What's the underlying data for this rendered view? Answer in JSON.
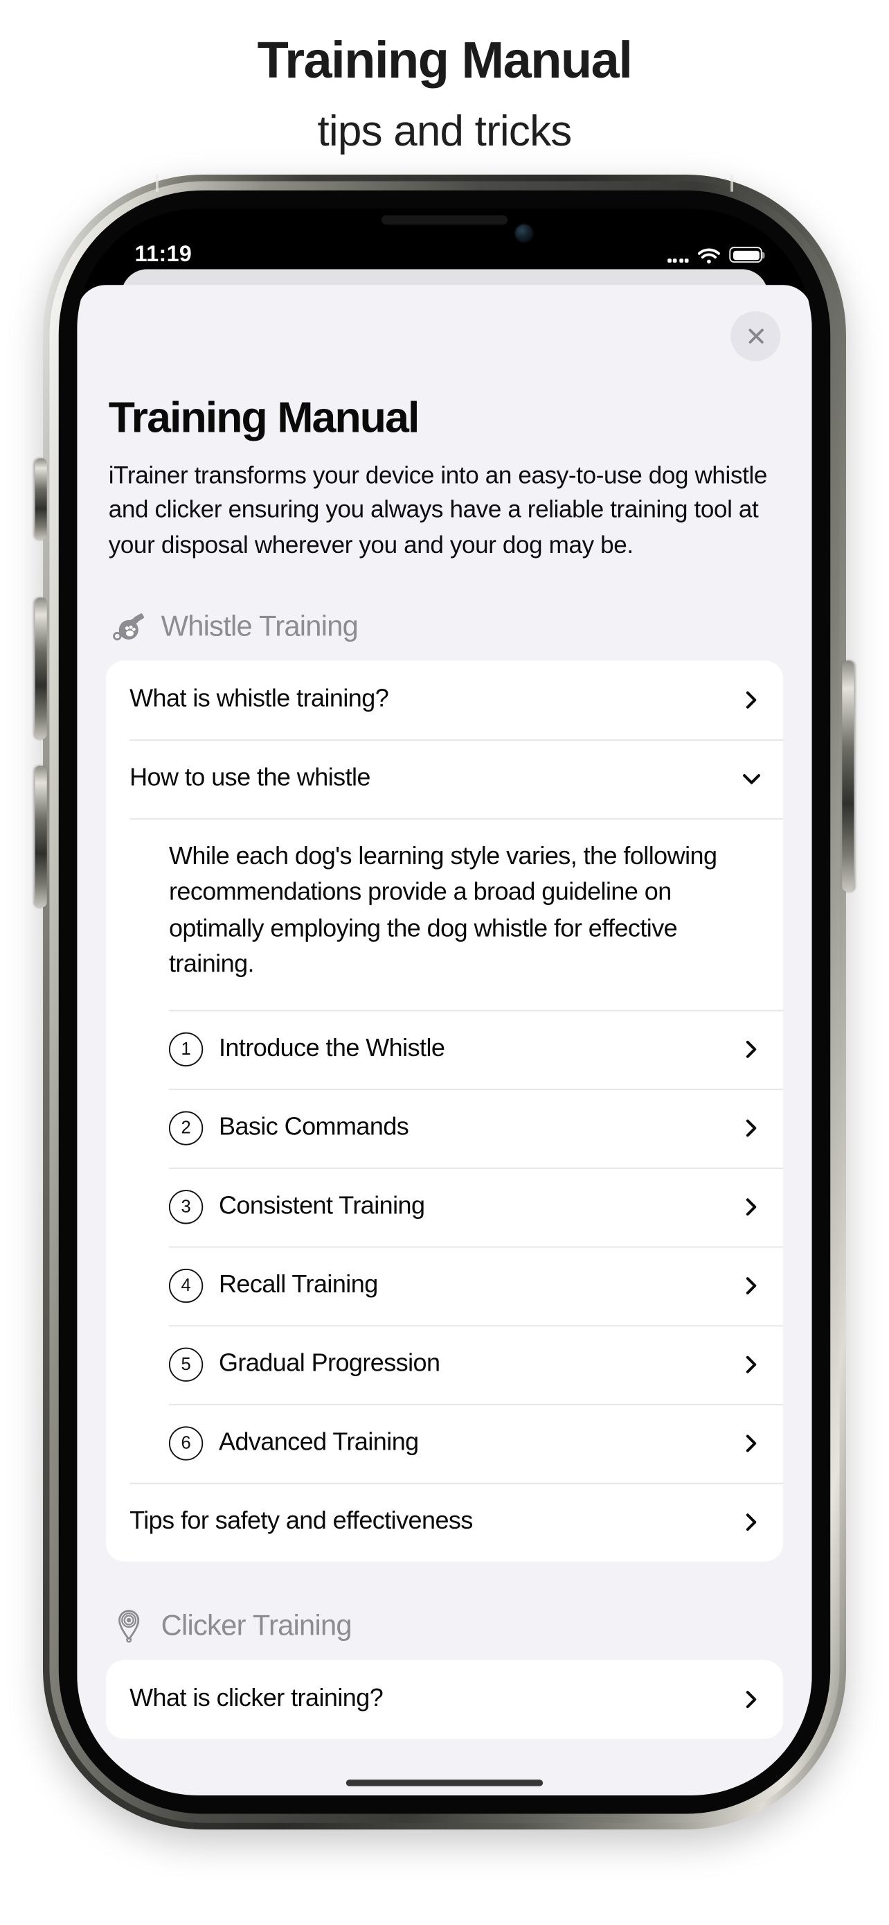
{
  "promo": {
    "title": "Training Manual",
    "subtitle": "tips and tricks"
  },
  "status_bar": {
    "time": "11:19",
    "signal_icon": "cellular-signal-icon",
    "wifi_icon": "wifi-icon",
    "battery_icon": "battery-icon"
  },
  "sheet": {
    "close_icon": "close-icon",
    "title": "Training Manual",
    "description": "iTrainer transforms your device into an easy-to-use dog whistle and clicker ensuring you always have a reliable training tool at your disposal wherever you and your dog may be.",
    "sections": [
      {
        "icon": "whistle-icon",
        "label": "Whistle Training",
        "rows": [
          {
            "label": "What is whistle training?",
            "accessory": "chevron-right-icon"
          },
          {
            "label": "How to use the whistle",
            "accessory": "chevron-down-icon",
            "expanded": true
          }
        ],
        "expanded_body": "While each dog's learning style varies, the following recommendations provide a broad guideline on optimally employing the dog whistle for effective training.",
        "steps": [
          {
            "number": "1",
            "label": "Introduce the Whistle",
            "accessory": "chevron-right-icon"
          },
          {
            "number": "2",
            "label": "Basic Commands",
            "accessory": "chevron-right-icon"
          },
          {
            "number": "3",
            "label": "Consistent Training",
            "accessory": "chevron-right-icon"
          },
          {
            "number": "4",
            "label": "Recall Training",
            "accessory": "chevron-right-icon"
          },
          {
            "number": "5",
            "label": "Gradual Progression",
            "accessory": "chevron-right-icon"
          },
          {
            "number": "6",
            "label": "Advanced Training",
            "accessory": "chevron-right-icon"
          }
        ],
        "footer_row": {
          "label": "Tips for safety and effectiveness",
          "accessory": "chevron-right-icon"
        }
      },
      {
        "icon": "clicker-icon",
        "label": "Clicker Training",
        "rows": [
          {
            "label": "What is clicker training?",
            "accessory": "chevron-right-icon"
          }
        ]
      }
    ]
  },
  "colors": {
    "sheet_background": "#f2f2f7",
    "card_background": "#ffffff",
    "section_label": "#8c8c92",
    "divider": "#e6e6e8",
    "text_primary": "#0a0a0a"
  }
}
